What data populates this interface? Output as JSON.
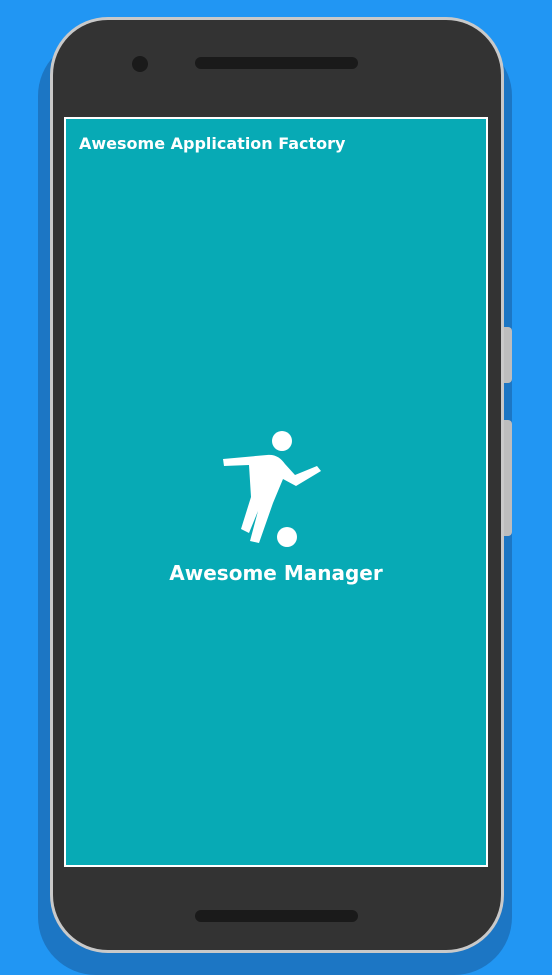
{
  "colors": {
    "background": "#2196F3",
    "screen": "#07AAB5",
    "text": "#ffffff",
    "phone_body": "#333333"
  },
  "header": {
    "title": "Awesome Application Factory"
  },
  "splash": {
    "logo_icon": "soccer-player-icon",
    "app_name": "Awesome Manager"
  }
}
